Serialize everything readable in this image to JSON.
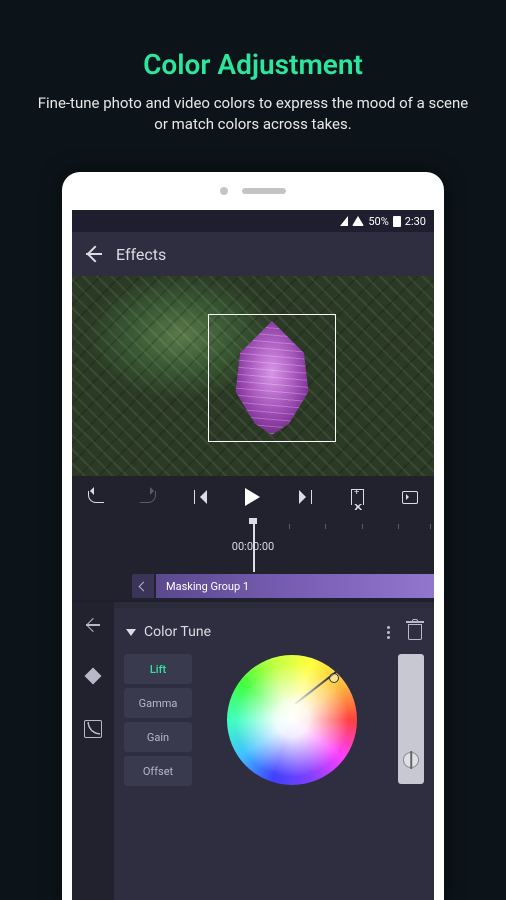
{
  "promo": {
    "title": "Color Adjustment",
    "subtitle": "Fine-tune photo and video colors to express the mood of a scene or match colors across takes."
  },
  "status_bar": {
    "battery": "50%",
    "time": "2:30"
  },
  "header": {
    "title": "Effects"
  },
  "timeline": {
    "timecode": "00:00:00",
    "clip_label": "Masking Group 1"
  },
  "panel": {
    "title": "Color Tune",
    "tabs": [
      "Lift",
      "Gamma",
      "Gain",
      "Offset"
    ],
    "active_tab": "Lift"
  }
}
